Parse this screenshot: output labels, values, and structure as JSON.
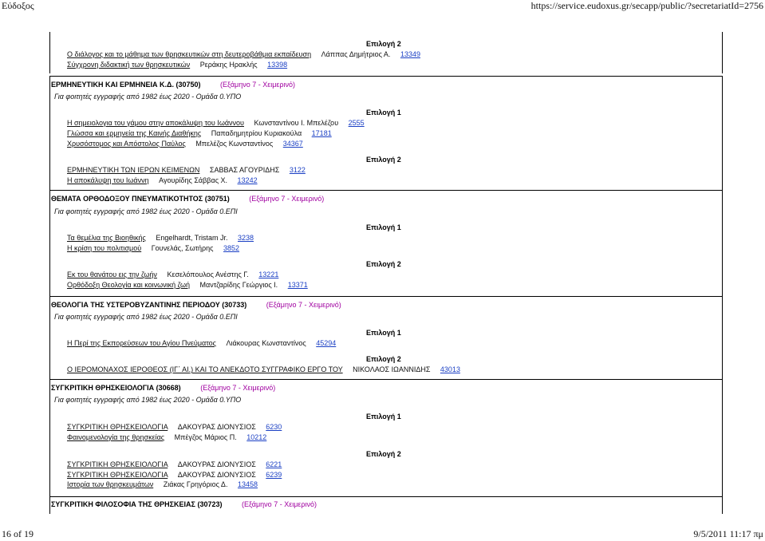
{
  "header": {
    "left": "Εύδοξος",
    "right": "https://service.eudoxus.gr/secapp/public/?secretariatId=2756"
  },
  "footer": {
    "left": "16 of 19",
    "right": "9/5/2011 11:17 πμ"
  },
  "top_block": {
    "choice": "Επιλογή 2",
    "books": [
      {
        "title": "Ο διάλογος και το μάθημα των θρησκευτικών στη δευτεροβάθμια εκπαίδευση",
        "author": "Λάππας Δημήτριος Α.",
        "code": "13349"
      },
      {
        "title": "Σύγχρονη διδακτική των θρησκευτικών",
        "author": "Ρεράκης Ηρακλής",
        "code": "13398"
      }
    ]
  },
  "courses": [
    {
      "title": "ΕΡΜΗΝΕΥΤΙΚΗ ΚΑΙ ΕΡΜΗΝΕΙΑ Κ.Δ. (30750)",
      "semester": "(Εξάμηνο 7 - Χειμερινό)",
      "subtitle": "Για φοιτητές εγγραφής από 1982 έως 2020 - Ομάδα 0.ΥΠΟ",
      "choices": [
        {
          "label": "Επιλογή 1",
          "books": [
            {
              "title": "Η σημειολογια του γάμου στην αποκάλυψη του Ιωάννου",
              "author": "Κωνσταντίνου Ι. Μπελέζου",
              "code": "2555"
            },
            {
              "title": "Γλώσσα και ερμηνεία της Καινής Διαθήκης",
              "author": "Παπαδημητρίου Κυριακούλα",
              "code": "17181"
            },
            {
              "title": "Χρυσόστομος και Απόστολος Παύλος",
              "author": "Μπελέζος Κωνσταντίνος",
              "code": "34367"
            }
          ]
        },
        {
          "label": "Επιλογή 2",
          "books": [
            {
              "title": "ΕΡΜΗΝΕΥΤΙΚΗ ΤΩΝ ΙΕΡΩΝ ΚΕΙΜΕΝΩΝ",
              "author": "ΣΑΒΒΑΣ ΑΓΟΥΡΙΔΗΣ",
              "code": "3122"
            },
            {
              "title": "Η αποκάλυψη του Ιωάννη",
              "author": "Αγουρίδης Σάββας Χ.",
              "code": "13242"
            }
          ]
        }
      ]
    },
    {
      "title": "ΘΕΜΑΤΑ ΟΡΘΟΔΟΞΟΥ ΠΝΕΥΜΑΤΙΚΟΤΗΤΟΣ (30751)",
      "semester": "(Εξάμηνο 7 - Χειμερινό)",
      "subtitle": "Για φοιτητές εγγραφής από 1982 έως 2020 - Ομάδα 0.ΕΠΙ",
      "choices": [
        {
          "label": "Επιλογή 1",
          "books": [
            {
              "title": "Τα θεμέλια της Βιοηθικής",
              "author": "Engelhardt, Tristam Jr.",
              "code": "3238"
            },
            {
              "title": "Η κρίση του πολιτισμού",
              "author": "Γουνελάς, Σωτήρης",
              "code": "3852"
            }
          ]
        },
        {
          "label": "Επιλογή 2",
          "books": [
            {
              "title": "Εκ του θανάτου εις την ζωήν",
              "author": "Κεσελόπουλος Ανέστης Γ.",
              "code": "13221"
            },
            {
              "title": "Ορθόδοξη Θεολογία και κοινωνική ζωή",
              "author": "Μαντζαρίδης Γεώργιος Ι.",
              "code": "13371"
            }
          ]
        }
      ]
    },
    {
      "title": "ΘΕΟΛΟΓΙΑ ΤΗΣ ΥΣΤΕΡΟΒΥΖΑΝΤΙΝΗΣ ΠΕΡΙΟΔΟΥ (30733)",
      "semester": "(Εξάμηνο 7 - Χειμερινό)",
      "subtitle": "Για φοιτητές εγγραφής από 1982 έως 2020 - Ομάδα 0.ΕΠΙ",
      "choices": [
        {
          "label": "Επιλογή 1",
          "books": [
            {
              "title": "Η Περί της Εκπορεύσεων του Αγίου Πνεύματος",
              "author": "Λιάκουρας Κωνσταντίνος",
              "code": "45294"
            }
          ]
        },
        {
          "label": "Επιλογή 2",
          "books": [
            {
              "title": "Ο ΙΕΡΟΜΟΝΑΧΟΣ ΙΕΡΟΘΕΟΣ (ΙΓ΄ ΑΙ.) ΚΑΙ ΤΟ ΑΝΕΚΔΟΤΟ ΣΥΓΓΡΑΦΙΚΟ ΕΡΓΟ ΤΟΥ",
              "author": "ΝΙΚΟΛΑΟΣ ΙΩΑΝΝΙΔΗΣ",
              "code": "43013"
            }
          ]
        }
      ]
    },
    {
      "title": "ΣΥΓΚΡΙΤΙΚΗ ΘΡΗΣΚΕΙΟΛΟΓΙΑ (30668)",
      "semester": "(Εξάμηνο 7 - Χειμερινό)",
      "subtitle": "Για φοιτητές εγγραφής από 1982 έως 2020 - Ομάδα 0.ΥΠΟ",
      "choices": [
        {
          "label": "Επιλογή 1",
          "books": [
            {
              "title": "ΣΥΓΚΡΙΤΙΚΗ ΘΡΗΣΚΕΙΟΛΟΓΙΑ",
              "author": "ΔΑΚΟΥΡΑΣ ΔΙΟΝΥΣΙΟΣ",
              "code": "6230"
            },
            {
              "title": "Φαινομενολογία της θρησκείας",
              "author": "Μπέγζος Μάριος Π.",
              "code": "10212"
            }
          ]
        },
        {
          "label": "Επιλογή 2",
          "books": [
            {
              "title": "ΣΥΓΚΡΙΤΙΚΗ ΘΡΗΣΚΕΙΟΛΟΓΙΑ",
              "author": "ΔΑΚΟΥΡΑΣ ΔΙΟΝΥΣΙΟΣ",
              "code": "6221"
            },
            {
              "title": "ΣΥΓΚΡΙΤΙΚΗ ΘΡΗΣΚΕΙΟΛΟΓΙΑ",
              "author": "ΔΑΚΟΥΡΑΣ ΔΙΟΝΥΣΙΟΣ",
              "code": "6239"
            },
            {
              "title": "Ιστορία των θρησκευμάτων",
              "author": "Ζιάκας Γρηγόριος Δ.",
              "code": "13458"
            }
          ]
        }
      ]
    },
    {
      "title": "ΣΥΓΚΡΙΤΙΚΗ ΦΙΛΟΣΟΦΙΑ ΤΗΣ ΘΡΗΣΚΕΙΑΣ (30723)",
      "semester": "(Εξάμηνο 7 - Χειμερινό)"
    }
  ]
}
